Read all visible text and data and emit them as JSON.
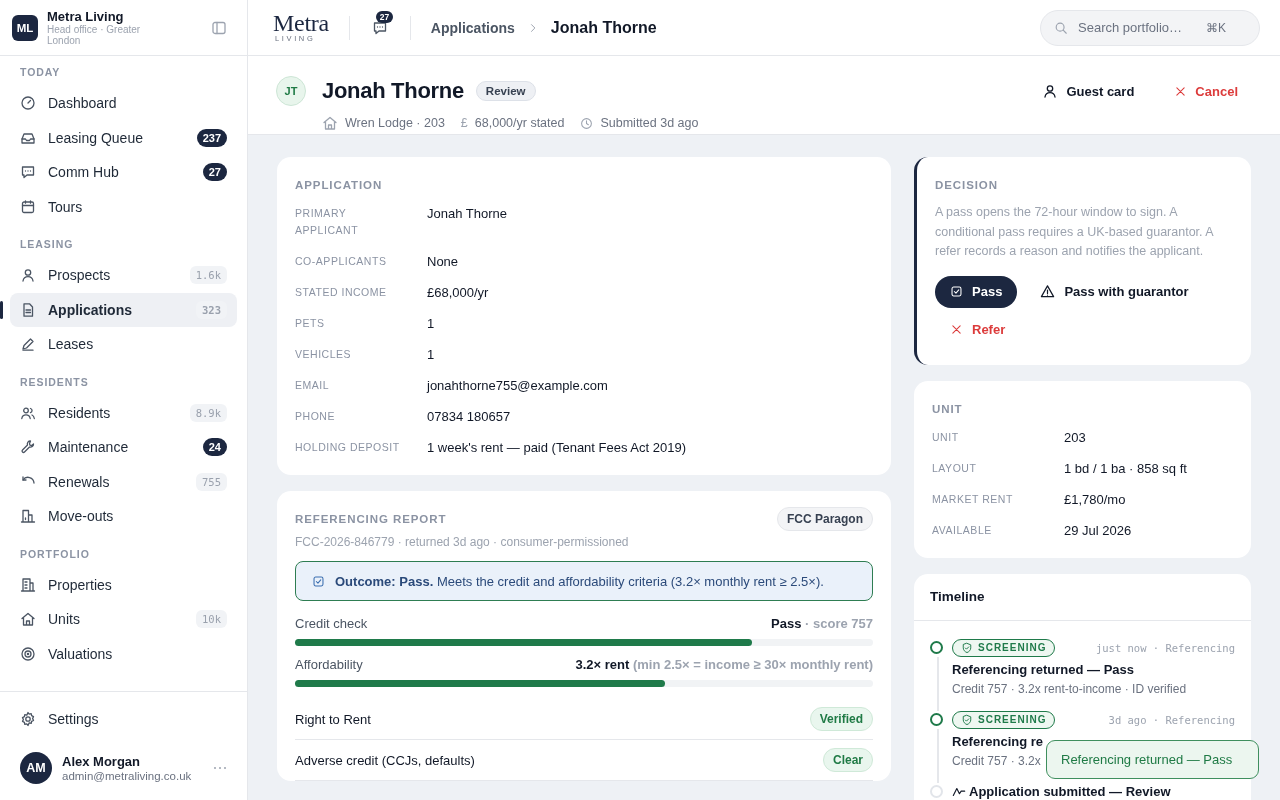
{
  "sidebar": {
    "org": {
      "initials": "ML",
      "name": "Metra Living",
      "subtitle": "Head office · Greater London"
    },
    "sections": [
      {
        "title": "TODAY",
        "items": [
          {
            "label": "Dashboard",
            "selected": false
          },
          {
            "label": "Leasing Queue",
            "count": "237",
            "count_emphasis": true,
            "selected": false
          },
          {
            "label": "Comm Hub",
            "count": "27",
            "count_emphasis": true,
            "selected": false
          },
          {
            "label": "Tours",
            "selected": false
          }
        ]
      },
      {
        "title": "LEASING",
        "items": [
          {
            "label": "Prospects",
            "count": "1.6k",
            "count_emphasis": false,
            "selected": false
          },
          {
            "label": "Applications",
            "count": "323",
            "count_emphasis": false,
            "selected": true
          },
          {
            "label": "Leases",
            "selected": false
          }
        ]
      },
      {
        "title": "RESIDENTS",
        "items": [
          {
            "label": "Residents",
            "count": "8.9k",
            "count_emphasis": false,
            "selected": false
          },
          {
            "label": "Maintenance",
            "count": "24",
            "count_emphasis": true,
            "selected": false
          },
          {
            "label": "Renewals",
            "count": "755",
            "count_emphasis": false,
            "selected": false
          },
          {
            "label": "Move-outs",
            "selected": false
          }
        ]
      },
      {
        "title": "PORTFOLIO",
        "items": [
          {
            "label": "Properties",
            "selected": false
          },
          {
            "label": "Units",
            "count": "10k",
            "count_emphasis": false,
            "selected": false
          },
          {
            "label": "Valuations",
            "selected": false
          }
        ]
      }
    ],
    "settings": "Settings",
    "user": {
      "initials": "AM",
      "name": "Alex Morgan",
      "email": "admin@metraliving.co.uk"
    }
  },
  "topbar": {
    "logo": {
      "word": "Metra",
      "tagline": "LIVING"
    },
    "messages_count": "27",
    "breadcrumb": [
      {
        "label": "Applications",
        "current": false
      },
      {
        "label": "Jonah Thorne",
        "current": true
      }
    ],
    "search": {
      "placeholder": "Search portfolio…",
      "shortcut": "⌘K"
    }
  },
  "header": {
    "initials": "JT",
    "name": "Jonah Thorne",
    "status": "Review",
    "meta": [
      {
        "text": "Wren Lodge · 203"
      },
      {
        "symbol": "£",
        "text": "68,000/yr stated"
      },
      {
        "text": "Submitted 3d ago"
      }
    ],
    "actions": [
      {
        "label": "Guest card",
        "kind": "plain"
      },
      {
        "label": "Cancel",
        "kind": "danger"
      }
    ]
  },
  "application": {
    "title": "APPLICATION",
    "fields": [
      {
        "label": "PRIMARY APPLICANT",
        "value": "Jonah Thorne"
      },
      {
        "label": "CO-APPLICANTS",
        "value": "None"
      },
      {
        "label": "STATED INCOME",
        "value": "£68,000/yr"
      },
      {
        "label": "PETS",
        "value": "1"
      },
      {
        "label": "VEHICLES",
        "value": "1"
      },
      {
        "label": "EMAIL",
        "value": "jonahthorne755@example.com"
      },
      {
        "label": "PHONE",
        "value": "07834 180657"
      },
      {
        "label": "HOLDING DEPOSIT",
        "value": "1 week's rent — paid (Tenant Fees Act 2019)"
      }
    ]
  },
  "referencing": {
    "title": "REFERENCING REPORT",
    "provider": "FCC Paragon",
    "reference": "FCC-2026-846779 · returned 3d ago · consumer-permissioned",
    "outcome": "**Outcome: Pass.** Meets the credit and affordability criteria (3.2× monthly rent ≥ 2.5×).",
    "checks": [
      {
        "label": "Credit check",
        "result": "**Pass** · score 757",
        "level": 0.79
      },
      {
        "label": "Affordability",
        "result": "**3.2× rent** (min 2.5× = income ≥ 30× monthly rent)",
        "level": 0.64
      }
    ],
    "items": [
      {
        "label": "Right to Rent",
        "status": "Verified"
      },
      {
        "label": "Adverse credit (CCJs, defaults)",
        "status": "Clear"
      }
    ]
  },
  "decision": {
    "title": "DECISION",
    "description": "A pass opens the 72-hour window to sign. A conditional pass requires a UK-based guarantor. A refer records a reason and notifies the applicant.",
    "actions": [
      {
        "label": "Pass",
        "kind": "primary"
      },
      {
        "label": "Pass with guarantor",
        "kind": "warning"
      },
      {
        "label": "Refer",
        "kind": "danger"
      }
    ]
  },
  "unit": {
    "title": "UNIT",
    "fields": [
      {
        "label": "UNIT",
        "value": "203"
      },
      {
        "label": "LAYOUT",
        "value": "1 bd / 1 ba · 858 sq ft"
      },
      {
        "label": "MARKET RENT",
        "value": "£1,780/mo"
      },
      {
        "label": "AVAILABLE",
        "value": "29 Jul 2026"
      }
    ]
  },
  "timeline": {
    "title": "Timeline",
    "events": [
      {
        "kind": "screening",
        "done": true,
        "tag": "SCREENING",
        "meta": "just now · Referencing",
        "title": "Referencing returned — Pass",
        "detail": "Credit 757 · 3.2x rent-to-income · ID verified"
      },
      {
        "kind": "screening",
        "done": true,
        "tag": "SCREENING",
        "meta": "3d ago · Referencing",
        "title": "Referencing re",
        "detail": "Credit 757 · 3.2x"
      },
      {
        "kind": "submitted",
        "done": false,
        "title": "Application submitted — Review"
      }
    ]
  },
  "toast": {
    "message": "Referencing returned — Pass"
  }
}
